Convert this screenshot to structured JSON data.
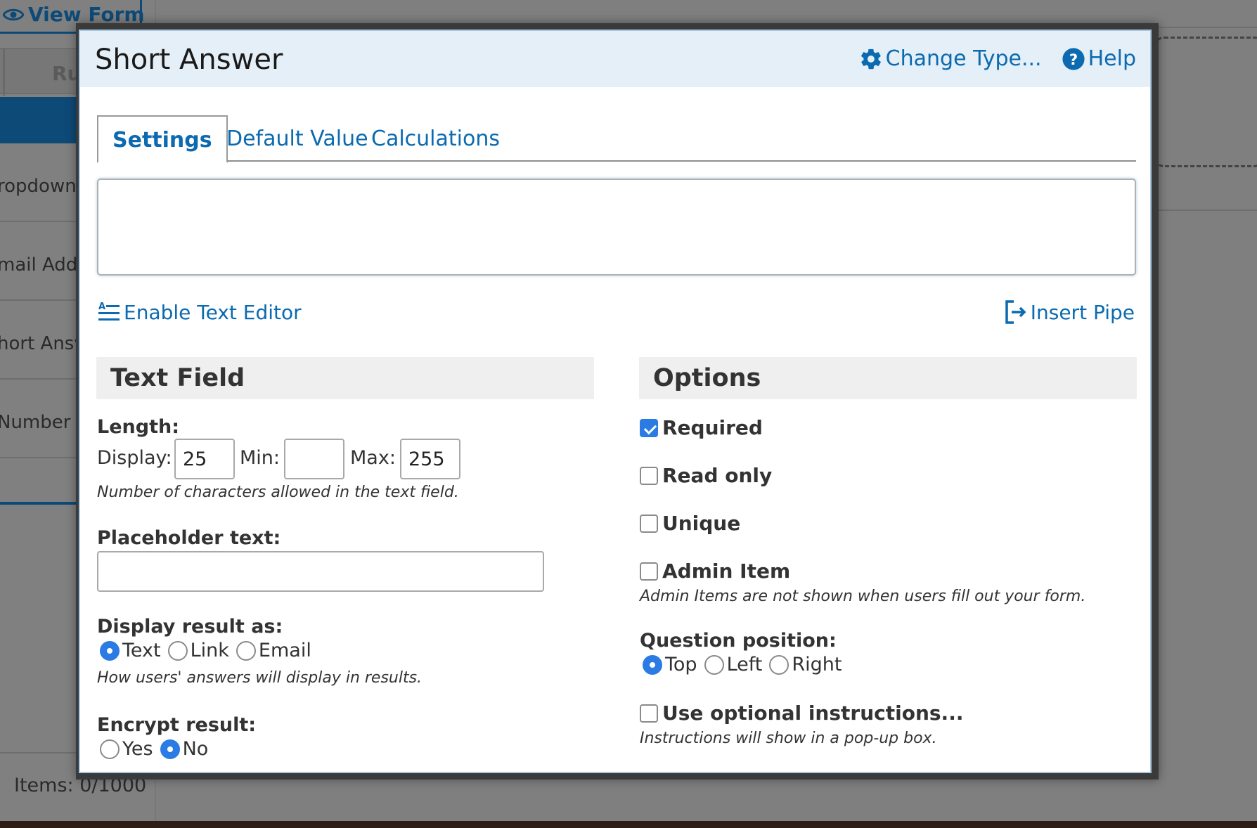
{
  "background": {
    "view_form": "View Form",
    "tab_run": "Ru",
    "sidebar_items": [
      "ropdown",
      "mail Addr",
      "hort Ansv",
      "Number"
    ],
    "items_count": "Items: 0/1000"
  },
  "modal": {
    "title": "Short Answer",
    "change_type": "Change Type...",
    "help": "Help",
    "tabs": [
      {
        "label": "Settings",
        "active": true
      },
      {
        "label": "Default Value",
        "active": false
      },
      {
        "label": "Calculations",
        "active": false
      }
    ],
    "question_text": "",
    "enable_text_editor": "Enable Text Editor",
    "insert_pipe": "Insert Pipe",
    "text_field": {
      "heading": "Text Field",
      "length_label": "Length:",
      "display_label": "Display:",
      "display_value": "25",
      "min_label": "Min:",
      "min_value": "",
      "max_label": "Max:",
      "max_value": "255",
      "length_hint": "Number of characters allowed in the text field.",
      "placeholder_label": "Placeholder text:",
      "placeholder_value": "",
      "display_result_label": "Display result as:",
      "display_result_options": [
        "Text",
        "Link",
        "Email"
      ],
      "display_result_selected": "Text",
      "display_result_hint": "How users' answers will display in results.",
      "encrypt_label": "Encrypt result:",
      "encrypt_options": [
        "Yes",
        "No"
      ],
      "encrypt_selected": "No"
    },
    "options": {
      "heading": "Options",
      "required": {
        "label": "Required",
        "checked": true
      },
      "read_only": {
        "label": "Read only",
        "checked": false
      },
      "unique": {
        "label": "Unique",
        "checked": false
      },
      "admin_item": {
        "label": "Admin Item",
        "checked": false
      },
      "admin_hint": "Admin Items are not shown when users fill out your form.",
      "question_position_label": "Question position:",
      "position_options": [
        "Top",
        "Left",
        "Right"
      ],
      "position_selected": "Top",
      "optional_instructions": {
        "label": "Use optional instructions...",
        "checked": false
      },
      "instructions_hint": "Instructions will show in a pop-up box."
    }
  },
  "colors": {
    "link": "#0b6ab0",
    "header_bg": "#e5eff7",
    "accent": "#2a7be4",
    "panel_bg": "#efefef"
  },
  "icons": [
    "eye-icon",
    "gear-icon",
    "help-circle-icon",
    "text-editor-icon",
    "insert-pipe-icon"
  ]
}
